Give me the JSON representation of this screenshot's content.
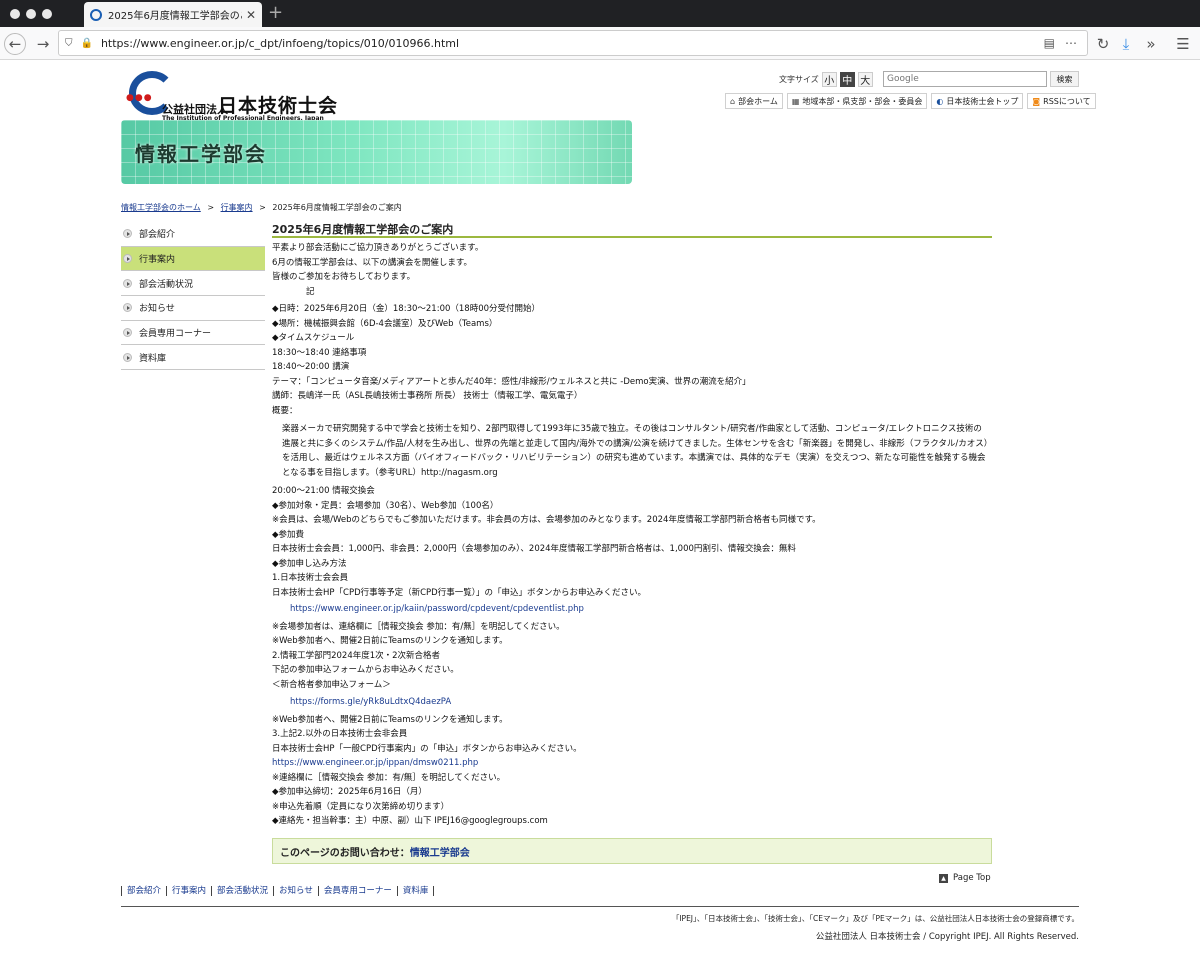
{
  "browser": {
    "tab_title": "2025年6月度情報工学部会のご案",
    "url": "https://www.engineer.or.jp/c_dpt/infoeng/topics/010/010966.html"
  },
  "header": {
    "logo": {
      "corp_prefix": "公益社団法人",
      "org_name": "日本技術士会",
      "org_name_en": "The Institution of Professional Engineers, Japan"
    },
    "font_size": {
      "label": "文字サイズ",
      "small": "小",
      "medium": "中",
      "large": "大"
    },
    "search": {
      "placeholder": "Google",
      "button": "検索"
    },
    "links": [
      {
        "label": "部会ホーム",
        "icon": "home-icon"
      },
      {
        "label": "地域本部・県支部・部会・委員会",
        "icon": "building-icon"
      },
      {
        "label": "日本技術士会トップ",
        "icon": "ipej-icon"
      },
      {
        "label": "RSSについて",
        "icon": "rss-icon"
      }
    ],
    "banner_title": "情報工学部会"
  },
  "breadcrumb": {
    "home": "情報工学部会のホーム",
    "events": "行事案内",
    "current": "2025年6月度情報工学部会のご案内",
    "separator": ">"
  },
  "sidebar": {
    "items": [
      {
        "label": "部会紹介"
      },
      {
        "label": "行事案内",
        "active": true
      },
      {
        "label": "部会活動状況"
      },
      {
        "label": "お知らせ"
      },
      {
        "label": "会員専用コーナー"
      },
      {
        "label": "資料庫"
      }
    ]
  },
  "main": {
    "title": "2025年6月度情報工学部会のご案内",
    "intro": [
      "平素より部会活動にご協力頂きありがとうございます。",
      "6月の情報工学部会は、以下の講演会を開催します。",
      "皆様のご参加をお待ちしております。",
      "　　　　記"
    ],
    "details": [
      "◆日時：2025年6月20日（金）18:30～21:00（18時00分受付開始）",
      "◆場所：機械振興会館（6D-4会議室）及びWeb（Teams）",
      "◆タイムスケジュール",
      " 18:30～18:40 連絡事項",
      " 18:40～20:00 講演",
      " テーマ：「コンピュータ音楽/メディアアートと歩んだ40年：感性/非線形/ウェルネスと共に -Demo実演、世界の潮流を紹介」",
      " 講師：長嶋洋一氏（ASL長嶋技術士事務所 所長） 技術士（情報工学、電気電子）",
      " 概要："
    ],
    "summary": "楽器メーカで研究開発する中で学会と技術士を知り、2部門取得して1993年に35歳で独立。その後はコンサルタント/研究者/作曲家として活動、コンピュータ/エレクトロニクス技術の進展と共に多くのシステム/作品/人材を生み出し、世界の先端と並走して国内/海外での講演/公演を続けてきました。生体センサを含む「新楽器」を開発し、非線形（フラクタル/カオス）を活用し、最近はウェルネス方面（バイオフィードバック・リハビリテーション）の研究も進めています。本講演では、具体的なデモ（実演）を交えつつ、新たな可能性を触発する機会となる事を目指します。（参考URL）http://nagasm.org",
    "lines_a": [
      " 20:00～21:00 情報交換会",
      "◆参加対象・定員：会場参加（30名）、Web参加（100名）",
      " ※会員は、会場/Webのどちらでもご参加いただけます。非会員の方は、会場参加のみとなります。2024年度情報工学部門新合格者も同様です。",
      "◆参加費",
      " 日本技術士会会員：1,000円、非会員：2,000円（会場参加のみ）、2024年度情報工学部門新合格者は、1,000円割引、情報交換会：無料",
      "◆参加申し込み方法",
      " 1.日本技術士会会員",
      "  日本技術士会HP「CPD行事等予定（新CPD行事一覧）」の「申込」ボタンからお申込みください。"
    ],
    "link_cpd": "https://www.engineer.or.jp/kaiin/password/cpdevent/cpdeventlist.php",
    "lines_b": [
      "  ※会場参加者は、連絡欄に［情報交換会 参加：有/無］を明記してください。",
      "  ※Web参加者へ、開催2日前にTeamsのリンクを通知します。",
      " 2.情報工学部門2024年度1次・2次新合格者",
      "  下記の参加申込フォームからお申込みください。",
      "  ＜新合格者参加申込フォーム＞"
    ],
    "link_form": "https://forms.gle/yRk8uLdtxQ4daezPA",
    "lines_c": [
      "  ※Web参加者へ、開催2日前にTeamsのリンクを通知します。",
      " 3.上記2.以外の日本技術士会非会員",
      "  日本技術士会HP「一般CPD行事案内」の「申込」ボタンからお申込みください。"
    ],
    "link_public": " https://www.engineer.or.jp/ippan/dmsw0211.php",
    "lines_d": [
      "  ※連絡欄に［情報交換会 参加：有/無］を明記してください。",
      " ◆参加申込締切：2025年6月16日（月）",
      "  ※申込先着順（定員になり次第締め切ります）",
      " ◆連絡先・担当幹事：主）中原、副）山下 IPEJ16@googlegroups.com"
    ],
    "contact_label": "このページのお問い合わせ：",
    "contact_link": "情報工学部会"
  },
  "pagetop": "Page Top",
  "footer": {
    "nav": [
      "部会紹介",
      "行事案内",
      "部会活動状況",
      "お知らせ",
      "会員専用コーナー",
      "資料庫"
    ],
    "trademark": "「IPEJ」、「日本技術士会」、「技術士会」、「CEマーク」及び「PEマーク」は、公益社団法人日本技術士会の登録商標です。",
    "copyright": "公益社団法人 日本技術士会 / Copyright IPEJ. All Rights Reserved."
  },
  "colors": {
    "accent_green": "#c9e07a",
    "link_blue": "#1a3b8f",
    "title_rule": "#9cb83f",
    "brand_blue": "#1a4f9c"
  }
}
